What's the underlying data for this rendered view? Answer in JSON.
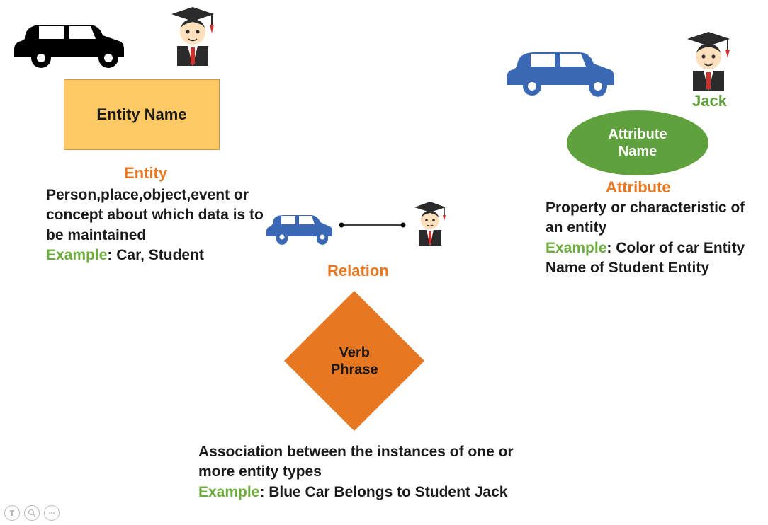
{
  "entity": {
    "box_label": "Entity Name",
    "title": "Entity",
    "description": "Person,place,object,event or concept about which data is to be maintained",
    "example_label": "Example",
    "example_text": ": Car, Student"
  },
  "attribute": {
    "jack_label": "Jack",
    "ellipse_label_1": "Attribute",
    "ellipse_label_2": "Name",
    "title": "Attribute",
    "description": "Property or characteristic of an entity",
    "example_label": "Example",
    "example_text": ": Color of car Entity Name of Student Entity"
  },
  "relation": {
    "title": "Relation",
    "diamond_label_1": "Verb",
    "diamond_label_2": "Phrase",
    "description": "Association between the instances of one or more entity types",
    "example_label": "Example",
    "example_text": ": Blue Car Belongs to Student Jack"
  }
}
